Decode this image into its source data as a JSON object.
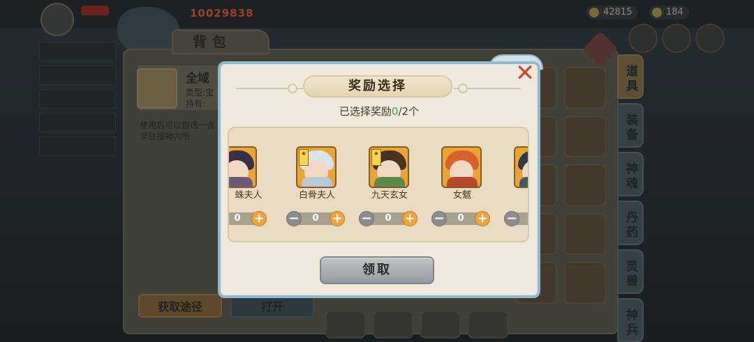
{
  "background": {
    "power_value": "10029838",
    "resource_1": "42815",
    "resource_2": "184",
    "bag_title": "背包",
    "item_name": "全域",
    "item_type": "类型:宝",
    "item_own": "持有:",
    "item_desc": "使用后可以自选一含常驻搜神内所",
    "btn_get": "获取途径",
    "btn_open": "打开",
    "side_tabs": [
      "道具",
      "装备",
      "神魂",
      "丹药",
      "灵兽",
      "神兵"
    ]
  },
  "modal": {
    "title": "奖励选择",
    "selected_prefix": "已选择奖励",
    "selected_count": "0",
    "selected_suffix": "/2个",
    "claim_label": "领取",
    "close_icon": "close-icon"
  },
  "rewards": [
    {
      "name": "蛛夫人",
      "value": "0"
    },
    {
      "name": "白骨夫人",
      "value": "0"
    },
    {
      "name": "九天玄女",
      "value": "0"
    },
    {
      "name": "女魃",
      "value": "0"
    }
  ],
  "colors": {
    "accent_green": "#34a844",
    "plus_orange": "#f0a43a",
    "close_red": "#c84a2c",
    "frame_blue": "#94b8c6"
  }
}
